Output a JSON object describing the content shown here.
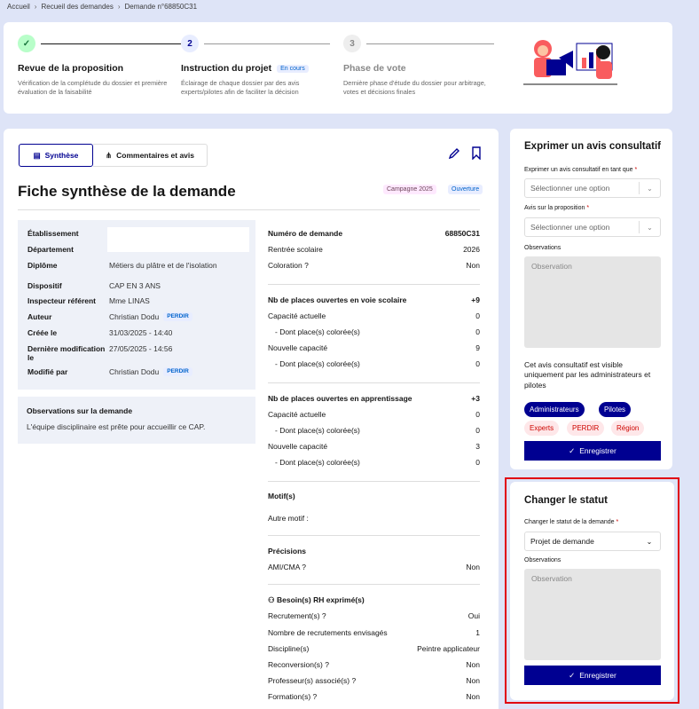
{
  "breadcrumb": [
    "Accueil",
    "Recueil des demandes",
    "Demande n°68850C31"
  ],
  "steps": [
    {
      "num": "✓",
      "title": "Revue de la proposition",
      "badge": "",
      "desc": "Vérification de la complétude du dossier et première évaluation de la faisabilité"
    },
    {
      "num": "2",
      "title": "Instruction du projet",
      "badge": "En cours",
      "desc": "Éclairage de chaque dossier par des avis experts/pilotes afin de faciliter la décision"
    },
    {
      "num": "3",
      "title": "Phase de vote",
      "badge": "",
      "desc": "Dernière phase d'étude du dossier pour arbitrage, votes et décisions finales"
    }
  ],
  "tabs": {
    "synthese": "Synthèse",
    "commentaires": "Commentaires et avis"
  },
  "page_title": "Fiche synthèse de la demande",
  "tags": {
    "campagne": "Campagne 2025",
    "ouverture": "Ouverture"
  },
  "info": {
    "etablissement_label": "Établissement",
    "departement_label": "Département",
    "diplome_label": "Diplôme",
    "diplome": "Métiers du plâtre et de l'isolation",
    "dispositif_label": "Dispositif",
    "dispositif": "CAP EN 3 ANS",
    "inspecteur_label": "Inspecteur référent",
    "inspecteur": "Mme LINAS",
    "auteur_label": "Auteur",
    "auteur": "Christian Dodu",
    "creee_label": "Créée le",
    "creee": "31/03/2025 - 14:40",
    "modif_label": "Dernière modification le",
    "modif": "27/05/2025 - 14:56",
    "modifie_par_label": "Modifié par",
    "modifie_par": "Christian Dodu",
    "perdir": "PERDIR"
  },
  "observations": {
    "title": "Observations sur la demande",
    "text": "L'équipe disciplinaire est prête pour accueillir ce CAP."
  },
  "right": {
    "num_label": "Numéro de demande",
    "num": "68850C31",
    "rentree_label": "Rentrée scolaire",
    "rentree": "2026",
    "coloration_label": "Coloration ?",
    "coloration": "Non",
    "vs_label": "Nb de places ouvertes en voie scolaire",
    "vs": "+9",
    "cap_act": "Capacité actuelle",
    "vs_act": "0",
    "dont_col": "- Dont place(s) colorée(s)",
    "vs_col1": "0",
    "nouv_cap": "Nouvelle capacité",
    "vs_new": "9",
    "vs_col2": "0",
    "app_label": "Nb de places ouvertes en apprentissage",
    "app": "+3",
    "app_act": "0",
    "app_col1": "0",
    "app_new": "3",
    "app_col2": "0",
    "motif_label": "Motif(s)",
    "autre_motif": "Autre motif :",
    "precisions_label": "Précisions",
    "ami_label": "AMI/CMA ?",
    "ami": "Non",
    "rh_label": "Besoin(s) RH exprimé(s)",
    "recrut_label": "Recrutement(s) ?",
    "recrut": "Oui",
    "nb_recrut_label": "Nombre de recrutements envisagés",
    "nb_recrut": "1",
    "discipline_label": "Discipline(s)",
    "discipline": "Peintre applicateur",
    "reconv_label": "Reconversion(s) ?",
    "reconv": "Non",
    "prof_label": "Professeur(s) associé(s) ?",
    "prof": "Non",
    "formation_label": "Formation(s) ?",
    "formation": "Non"
  },
  "avis": {
    "title": "Exprimer un avis consultatif",
    "en_tant_que_label": "Exprimer un avis consultatif en tant que",
    "select_placeholder": "Sélectionner une option",
    "avis_label": "Avis sur la proposition",
    "observations_label": "Observations",
    "observation_placeholder": "Observation",
    "visible_text": "Cet avis consultatif est visible uniquement par les administrateurs et pilotes",
    "chips": [
      "Administrateurs",
      "Pilotes",
      "Experts",
      "PERDIR",
      "Région"
    ],
    "save": "Enregistrer"
  },
  "statut": {
    "title": "Changer le statut",
    "label": "Changer le statut de la demande",
    "value": "Projet de demande",
    "observations_label": "Observations",
    "observation_placeholder": "Observation",
    "save": "Enregistrer"
  },
  "colors": {
    "primary": "#000091",
    "background": "#dee4f7",
    "success": "#18753c",
    "highlight": "#e1000f"
  }
}
